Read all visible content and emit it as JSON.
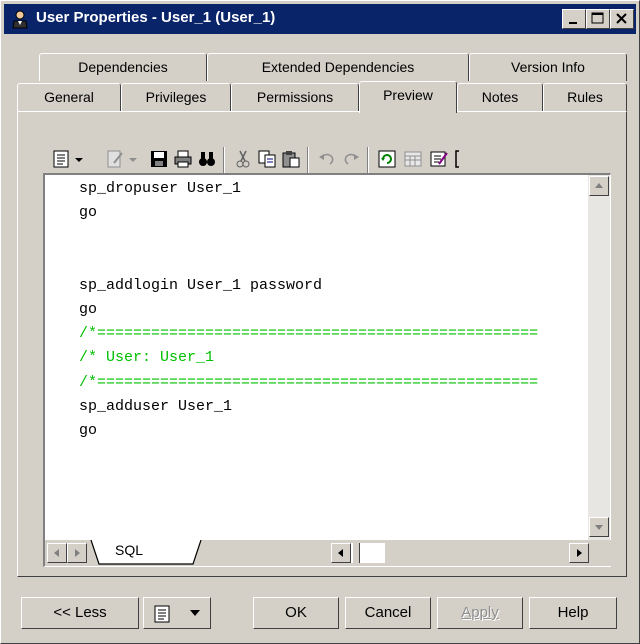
{
  "window": {
    "title": "User Properties - User_1 (User_1)"
  },
  "tabs": {
    "back_row": [
      "Dependencies",
      "Extended Dependencies",
      "Version Info"
    ],
    "front_row": [
      "General",
      "Privileges",
      "Permissions",
      "Preview",
      "Notes",
      "Rules"
    ],
    "active": "Preview"
  },
  "toolbar": {
    "icons": [
      "preview-menu-icon",
      "dropdown-arrow-icon",
      "edit-icon",
      "dropdown-arrow-icon",
      "save-icon",
      "print-icon",
      "find-icon",
      "cut-icon",
      "copy-icon",
      "paste-icon",
      "undo-icon",
      "redo-icon",
      "refresh-icon",
      "calculator-icon",
      "edit-properties-icon"
    ]
  },
  "editor": {
    "lines": [
      {
        "text": "sp_dropuser User_1",
        "style": "normal"
      },
      {
        "text": "go",
        "style": "normal"
      },
      {
        "text": "",
        "style": "normal"
      },
      {
        "text": "",
        "style": "normal"
      },
      {
        "text": "sp_addlogin User_1 password",
        "style": "normal"
      },
      {
        "text": "go",
        "style": "normal"
      },
      {
        "text": "/*=================================================",
        "style": "comment"
      },
      {
        "text": "/* User: User_1",
        "style": "comment"
      },
      {
        "text": "/*=================================================",
        "style": "comment"
      },
      {
        "text": "sp_adduser User_1",
        "style": "normal"
      },
      {
        "text": "go",
        "style": "normal"
      }
    ],
    "sheet_tab": "SQL"
  },
  "buttons": {
    "less": "<< Less",
    "ok": "OK",
    "cancel": "Cancel",
    "apply": "Apply",
    "help": "Help"
  },
  "colors": {
    "titlebar": "#0a246a",
    "comment": "#00c000",
    "face": "#d4d0c8"
  }
}
